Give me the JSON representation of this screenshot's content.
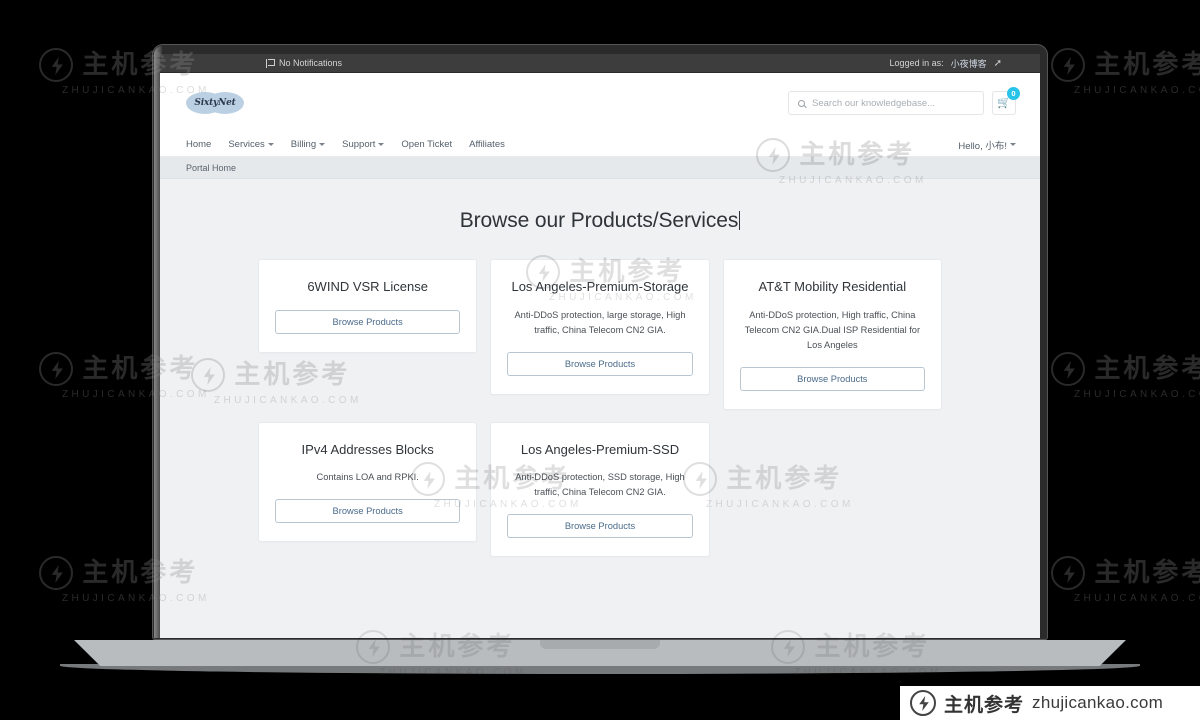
{
  "topbar": {
    "notifications_label": "No Notifications",
    "notifications_icon": "flag-icon",
    "logged_in_label": "Logged in as:",
    "username": "小夜博客",
    "logout_icon": "logout-icon"
  },
  "header": {
    "logo_text": "SixtyNet",
    "search": {
      "placeholder": "Search our knowledgebase...",
      "value": "",
      "icon": "search-icon"
    },
    "cart": {
      "icon": "cart-icon",
      "badge_count": "0",
      "badge_color": "#28c3e8"
    }
  },
  "nav": {
    "items": [
      {
        "label": "Home",
        "has_caret": false
      },
      {
        "label": "Services",
        "has_caret": true
      },
      {
        "label": "Billing",
        "has_caret": true
      },
      {
        "label": "Support",
        "has_caret": true
      },
      {
        "label": "Open Ticket",
        "has_caret": false
      },
      {
        "label": "Affiliates",
        "has_caret": false
      }
    ],
    "account_label": "Hello, 小布!",
    "account_has_caret": true
  },
  "breadcrumb": {
    "items": [
      "Portal Home"
    ]
  },
  "main": {
    "title": "Browse our Products/Services",
    "cards": [
      {
        "title": "6WIND VSR License",
        "description": "",
        "button_label": "Browse Products"
      },
      {
        "title": "Los Angeles-Premium-Storage",
        "description": "Anti-DDoS protection, large storage, High traffic, China Telecom CN2 GIA.",
        "button_label": "Browse Products"
      },
      {
        "title": "AT&T Mobility Residential",
        "description": "Anti-DDoS protection, High traffic, China Telecom CN2 GIA.Dual ISP Residential for Los Angeles",
        "button_label": "Browse Products"
      },
      {
        "title": "IPv4 Addresses Blocks",
        "description": "Contains LOA and RPKI.",
        "button_label": "Browse Products"
      },
      {
        "title": "Los Angeles-Premium-SSD",
        "description": "Anti-DDoS protection, SSD storage, High traffic, China Telecom CN2 GIA.",
        "button_label": "Browse Products"
      }
    ]
  },
  "watermark": {
    "cn_text": "主机参考",
    "en_text": "ZHUJICANKAO.COM",
    "banner_cn": "主机参考",
    "banner_en": "zhujicankao.com",
    "logo_icon": "lightning-circle-icon"
  },
  "colors": {
    "accent": "#28c3e8",
    "button_border": "#b8c6d2",
    "button_text": "#4a6b8a",
    "page_bg": "#f0f1f3",
    "topbar_bg": "#3d3d3d"
  }
}
